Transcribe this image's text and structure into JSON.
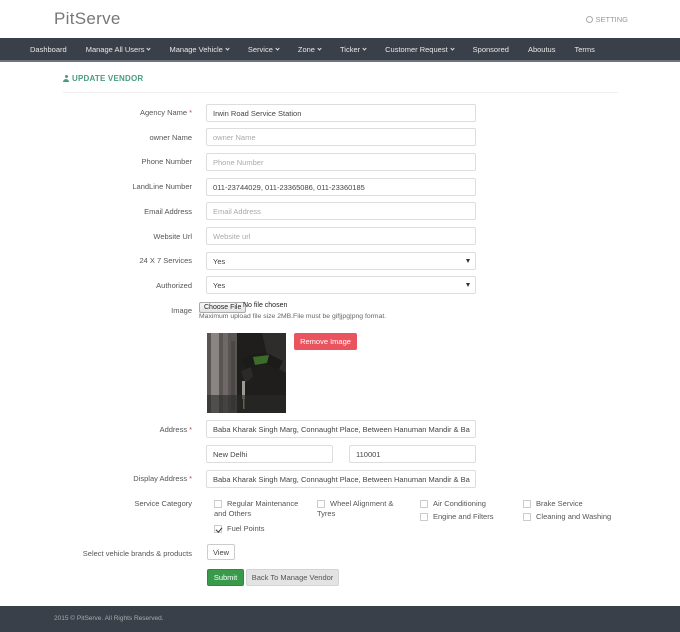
{
  "app": {
    "title": "PitServe",
    "setting_label": "SETTING"
  },
  "nav": {
    "items": [
      {
        "label": "Dashboard",
        "caret": false
      },
      {
        "label": "Manage All Users",
        "caret": true
      },
      {
        "label": "Manage Vehicle",
        "caret": true
      },
      {
        "label": "Service",
        "caret": true
      },
      {
        "label": "Zone",
        "caret": true
      },
      {
        "label": "Ticker",
        "caret": true
      },
      {
        "label": "Customer Request",
        "caret": true
      },
      {
        "label": "Sponsored",
        "caret": false
      },
      {
        "label": "Aboutus",
        "caret": false
      },
      {
        "label": "Terms",
        "caret": false
      }
    ]
  },
  "form": {
    "heading": "UPDATE VENDOR",
    "agency_name": {
      "label": "Agency Name",
      "value": "Irwin Road Service Station"
    },
    "owner_name": {
      "label": "owner Name",
      "placeholder": "owner Name"
    },
    "phone_number": {
      "label": "Phone Number",
      "placeholder": "Phone Number"
    },
    "landline_number": {
      "label": "LandLine Number",
      "value": "011-23744029, 011-23365086, 011-23360185"
    },
    "email_address": {
      "label": "Email Address",
      "placeholder": "Email Address"
    },
    "website_url": {
      "label": "Website Url",
      "placeholder": "Website url"
    },
    "services_24x7": {
      "label": "24 X 7 Services",
      "value": "Yes"
    },
    "authorized": {
      "label": "Authorized",
      "value": "Yes"
    },
    "image": {
      "label": "Image",
      "choose_file": "Choose File",
      "no_file": "No file chosen",
      "hint": "Maximum upload file size 2MB.File must be gif|jpg|png format.",
      "remove_label": "Remove Image"
    },
    "address": {
      "label": "Address",
      "line": "Baba Kharak Singh Marg, Connaught Place, Between Hanuman Mandir & Ba",
      "city": "New Delhi",
      "pincode": "110001"
    },
    "display_address": {
      "label": "Display Address",
      "value": "Baba Kharak Singh Marg, Connaught Place, Between Hanuman Mandir & Ba"
    },
    "service_category": {
      "label": "Service Category",
      "options": [
        {
          "label_line1": "Regular Maintenance",
          "label_line2": "and Others",
          "checked": false
        },
        {
          "label_line1": "Wheel Alignment &",
          "label_line2": "Tyres",
          "checked": false
        },
        {
          "label_line1": "Air Conditioning",
          "checked": false
        },
        {
          "label_line1": "Brake Service",
          "checked": false
        },
        {
          "label_line1": "Engine and Filters",
          "checked": false
        },
        {
          "label_line1": "Cleaning and Washing",
          "checked": false
        },
        {
          "label_line1": "Fuel Points",
          "checked": true
        }
      ]
    },
    "vehicle_brands": {
      "label": "Select vehicle brands & products",
      "button": "View"
    },
    "submit_label": "Submit",
    "back_label": "Back To Manage Vendor"
  },
  "footer": {
    "text": "2015 © PitServe. All Rights Reserved."
  }
}
